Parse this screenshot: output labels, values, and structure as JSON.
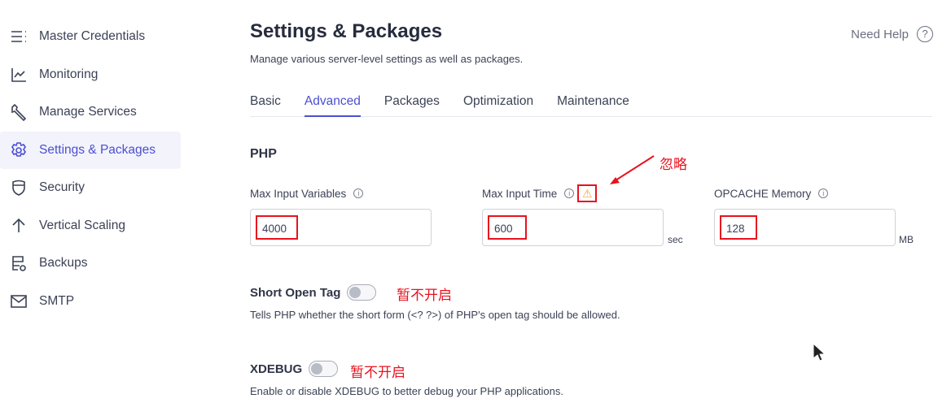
{
  "sidebar": {
    "items": [
      {
        "label": "Master Credentials",
        "icon": "list-icon"
      },
      {
        "label": "Monitoring",
        "icon": "chart-line-icon"
      },
      {
        "label": "Manage Services",
        "icon": "wrench-icon"
      },
      {
        "label": "Settings & Packages",
        "icon": "gear-icon",
        "active": true
      },
      {
        "label": "Security",
        "icon": "shield-icon"
      },
      {
        "label": "Vertical Scaling",
        "icon": "arrow-up-icon"
      },
      {
        "label": "Backups",
        "icon": "backup-icon"
      },
      {
        "label": "SMTP",
        "icon": "mail-icon"
      }
    ]
  },
  "header": {
    "title": "Settings & Packages",
    "subtitle": "Manage various server-level settings as well as packages.",
    "help": "Need Help",
    "help_icon": "?"
  },
  "tabs": [
    "Basic",
    "Advanced",
    "Packages",
    "Optimization",
    "Maintenance"
  ],
  "active_tab": "Advanced",
  "php": {
    "section": "PHP",
    "fields": [
      {
        "label": "Max Input Variables",
        "value": "4000",
        "unit": ""
      },
      {
        "label": "Max Input Time",
        "value": "600",
        "unit": "sec"
      },
      {
        "label": "OPCACHE Memory",
        "value": "128",
        "unit": "MB"
      }
    ],
    "short_open_tag": {
      "label": "Short Open Tag",
      "enabled": false,
      "desc": "Tells PHP whether the short form (<? ?>) of PHP's open tag should be allowed."
    },
    "xdebug": {
      "label": "XDEBUG",
      "enabled": false,
      "desc": "Enable or disable XDEBUG to better debug your PHP applications."
    }
  },
  "annotations": {
    "ignore": "忽略",
    "not_enable_1": "暂不开启",
    "not_enable_2": "暂不开启",
    "color": "#e8121e"
  },
  "warning_color": "#f2a43a",
  "accent": "#4b4fd1"
}
